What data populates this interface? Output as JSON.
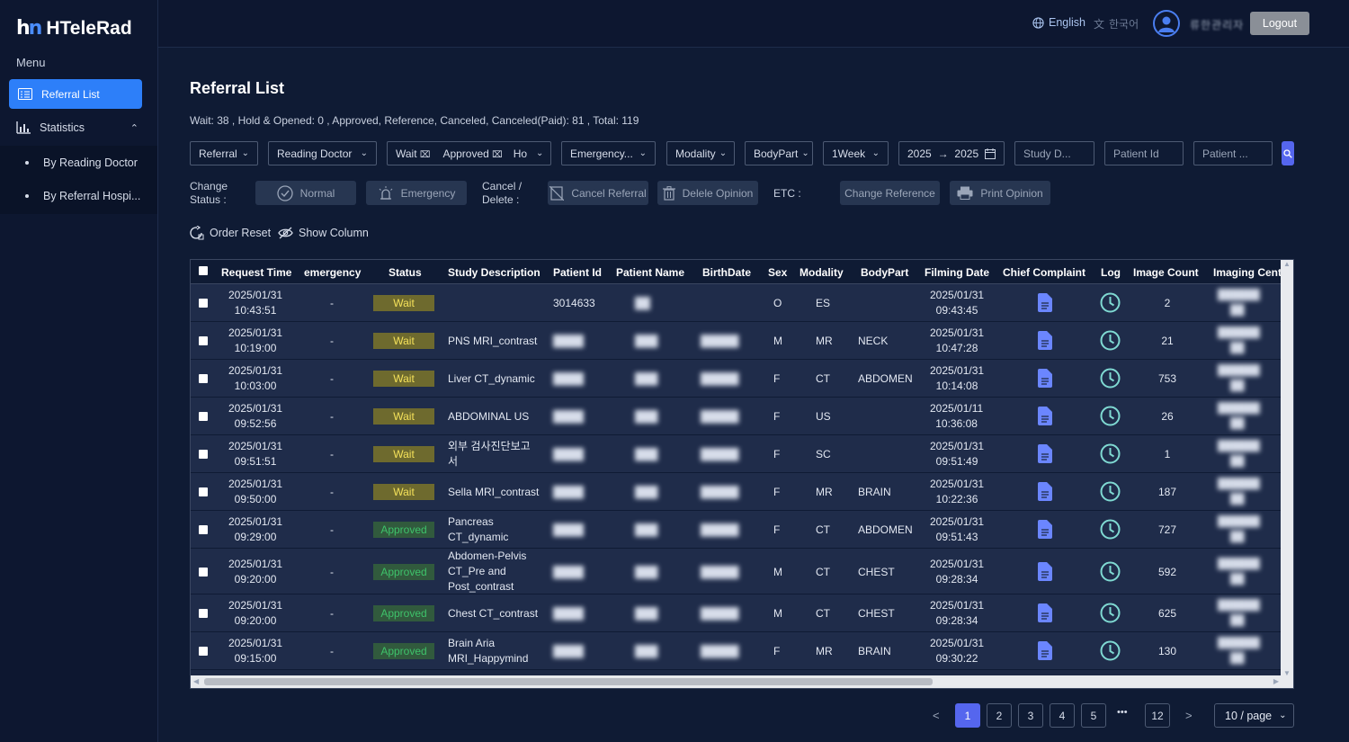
{
  "app": {
    "logo_mark": "h",
    "logo_mark_b": "n",
    "title": "HTeleRad"
  },
  "sidebar": {
    "menu_label": "Menu",
    "active_item": "Referral List",
    "statistics": "Statistics",
    "sub_items": [
      "By Reading Doctor",
      "By Referral Hospi..."
    ]
  },
  "topbar": {
    "lang_en": "English",
    "lang_ko": "한국어",
    "username": "류한관리자",
    "logout": "Logout"
  },
  "page": {
    "title": "Referral List",
    "summary": "Wait: 38 ,  Hold & Opened: 0 ,  Approved, Reference, Canceled, Canceled(Paid): 81 ,  Total: 119"
  },
  "filters": {
    "referral": "Referral",
    "reading_doctor": "Reading Doctor",
    "status_tags": [
      "Wait",
      "Approved"
    ],
    "status_more": "Ho",
    "emergency": "Emergency...",
    "modality": "Modality",
    "bodypart": "BodyPart",
    "period": "1Week",
    "date_from": "2025",
    "date_arrow": "→",
    "date_to": "2025",
    "study_placeholder": "Study D...",
    "patient_id_placeholder": "Patient Id",
    "patient_name_placeholder": "Patient ..."
  },
  "actions": {
    "change_status_label": "Change Status :",
    "normal": "Normal",
    "emergency": "Emergency",
    "cancel_delete_label": "Cancel / Delete :",
    "cancel_referral": "Cancel Referral",
    "delete_opinion": "Delele Opinion",
    "etc_label": "ETC :",
    "change_reference": "Change Reference",
    "print_opinion": "Print Opinion",
    "order_reset": "Order Reset",
    "show_column": "Show Column"
  },
  "table": {
    "columns": [
      "Request Time",
      "emergency",
      "Status",
      "Study Description",
      "Patient Id",
      "Patient Name",
      "BirthDate",
      "Sex",
      "Modality",
      "BodyPart",
      "Filming Date",
      "Chief Complaint",
      "Log",
      "Image Count",
      "Imaging Cent"
    ],
    "rows": [
      {
        "req": [
          "2025/01/31",
          "10:43:51"
        ],
        "emergency": "-",
        "status": "Wait",
        "study": [
          "",
          ""
        ],
        "pid": "3014633",
        "pname": "██",
        "birth": "",
        "sex": "O",
        "modality": "ES",
        "bodypart": "",
        "film": [
          "2025/01/31",
          "09:43:45"
        ],
        "count": "2",
        "center": [
          "██████",
          "██"
        ]
      },
      {
        "req": [
          "2025/01/31",
          "10:19:00"
        ],
        "emergency": "-",
        "status": "Wait",
        "study": [
          "PNS MRI_contrast",
          ""
        ],
        "pid": "████",
        "pname": "███",
        "birth": "█████",
        "sex": "M",
        "modality": "MR",
        "bodypart": "NECK",
        "film": [
          "2025/01/31",
          "10:47:28"
        ],
        "count": "21",
        "center": [
          "██████",
          "██"
        ]
      },
      {
        "req": [
          "2025/01/31",
          "10:03:00"
        ],
        "emergency": "-",
        "status": "Wait",
        "study": [
          "Liver CT_dynamic",
          ""
        ],
        "pid": "████",
        "pname": "███",
        "birth": "█████",
        "sex": "F",
        "modality": "CT",
        "bodypart": "ABDOMEN",
        "film": [
          "2025/01/31",
          "10:14:08"
        ],
        "count": "753",
        "center": [
          "██████",
          "██"
        ]
      },
      {
        "req": [
          "2025/01/31",
          "09:52:56"
        ],
        "emergency": "-",
        "status": "Wait",
        "study": [
          "ABDOMINAL US",
          ""
        ],
        "pid": "████",
        "pname": "███",
        "birth": "█████",
        "sex": "F",
        "modality": "US",
        "bodypart": "",
        "film": [
          "2025/01/11",
          "10:36:08"
        ],
        "count": "26",
        "center": [
          "██████",
          "██"
        ]
      },
      {
        "req": [
          "2025/01/31",
          "09:51:51"
        ],
        "emergency": "-",
        "status": "Wait",
        "study": [
          "외부 검사진단보고",
          "서"
        ],
        "pid": "████",
        "pname": "███",
        "birth": "█████",
        "sex": "F",
        "modality": "SC",
        "bodypart": "",
        "film": [
          "2025/01/31",
          "09:51:49"
        ],
        "count": "1",
        "center": [
          "██████",
          "██"
        ]
      },
      {
        "req": [
          "2025/01/31",
          "09:50:00"
        ],
        "emergency": "-",
        "status": "Wait",
        "study": [
          "Sella MRI_contrast",
          ""
        ],
        "pid": "████",
        "pname": "███",
        "birth": "█████",
        "sex": "F",
        "modality": "MR",
        "bodypart": "BRAIN",
        "film": [
          "2025/01/31",
          "10:22:36"
        ],
        "count": "187",
        "center": [
          "██████",
          "██"
        ]
      },
      {
        "req": [
          "2025/01/31",
          "09:29:00"
        ],
        "emergency": "-",
        "status": "Approved",
        "study": [
          "Pancreas",
          "CT_dynamic"
        ],
        "pid": "████",
        "pname": "███",
        "birth": "█████",
        "sex": "F",
        "modality": "CT",
        "bodypart": "ABDOMEN",
        "film": [
          "2025/01/31",
          "09:51:43"
        ],
        "count": "727",
        "center": [
          "██████",
          "██"
        ]
      },
      {
        "req": [
          "2025/01/31",
          "09:20:00"
        ],
        "emergency": "-",
        "status": "Approved",
        "study": [
          "Abdomen-Pelvis",
          "CT_Pre and",
          "Post_contrast"
        ],
        "pid": "████",
        "pname": "███",
        "birth": "█████",
        "sex": "M",
        "modality": "CT",
        "bodypart": "CHEST",
        "film": [
          "2025/01/31",
          "09:28:34"
        ],
        "count": "592",
        "center": [
          "██████",
          "██"
        ]
      },
      {
        "req": [
          "2025/01/31",
          "09:20:00"
        ],
        "emergency": "-",
        "status": "Approved",
        "study": [
          "Chest CT_contrast",
          ""
        ],
        "pid": "████",
        "pname": "███",
        "birth": "█████",
        "sex": "M",
        "modality": "CT",
        "bodypart": "CHEST",
        "film": [
          "2025/01/31",
          "09:28:34"
        ],
        "count": "625",
        "center": [
          "██████",
          "██"
        ]
      },
      {
        "req": [
          "2025/01/31",
          "09:15:00"
        ],
        "emergency": "-",
        "status": "Approved",
        "study": [
          "Brain Aria",
          "MRI_Happymind"
        ],
        "pid": "████",
        "pname": "███",
        "birth": "█████",
        "sex": "F",
        "modality": "MR",
        "bodypart": "BRAIN",
        "film": [
          "2025/01/31",
          "09:30:22"
        ],
        "count": "130",
        "center": [
          "██████",
          "██"
        ]
      }
    ]
  },
  "pagination": {
    "pages": [
      "1",
      "2",
      "3",
      "4",
      "5"
    ],
    "ellipsis": "•••",
    "last": "12",
    "prev": "<",
    "next": ">",
    "page_size": "10 / page"
  },
  "colors": {
    "accent": "#2d7ff9",
    "wait": "#f4e15a",
    "approved": "#3ec26a",
    "icon": "#6b86ff",
    "log": "#7fd9d2"
  }
}
